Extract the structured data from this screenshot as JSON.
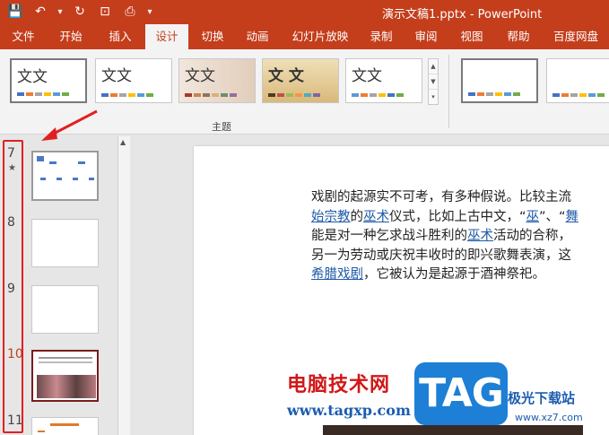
{
  "titlebar": {
    "title": "演示文稿1.pptx - PowerPoint",
    "qat": [
      {
        "name": "save-icon",
        "glyph": "💾"
      },
      {
        "name": "undo-icon",
        "glyph": "↶"
      },
      {
        "name": "undo-dropdown-icon",
        "glyph": "▾"
      },
      {
        "name": "redo-icon",
        "glyph": "↻"
      },
      {
        "name": "present-icon",
        "glyph": "⊡"
      },
      {
        "name": "preview-icon",
        "glyph": "⎙"
      },
      {
        "name": "qat-customize-icon",
        "glyph": "▾"
      }
    ]
  },
  "tabs": [
    "文件",
    "开始",
    "插入",
    "设计",
    "切换",
    "动画",
    "幻灯片放映",
    "录制",
    "审阅",
    "视图",
    "帮助",
    "百度网盘"
  ],
  "active_tab": "设计",
  "ribbon": {
    "themes_group_label": "主题",
    "theme_text": "文文",
    "theme_text_sample": "文 文"
  },
  "slides": [
    {
      "number": "7",
      "has_star": true
    },
    {
      "number": "8",
      "has_star": false
    },
    {
      "number": "9",
      "has_star": false
    },
    {
      "number": "10",
      "has_star": false
    },
    {
      "number": "11",
      "has_star": false
    }
  ],
  "slide_star": "★",
  "slide_content": {
    "line1": "戏剧的起源实不可考，有多种假说。比较主流",
    "line2_link1": "始宗教",
    "line2_mid1": "的",
    "line2_link2": "巫术",
    "line2_mid2": "仪式，比如上古中文，“",
    "line2_link3": "巫",
    "line2_mid3": "”、“",
    "line2_link4": "舞",
    "line3_pre": "能是对一种乞求战斗胜利的",
    "line3_link": "巫术",
    "line3_post": "活动的合称，",
    "line4": "另一为劳动或庆祝丰收时的即兴歌舞表演，这",
    "line5_link": "希腊戏剧",
    "line5_post": "，它被认为是起源于酒神祭祀。"
  },
  "watermark": {
    "cn_name": "电脑技术网",
    "url": "www.tagxp.com",
    "tag": "TAG",
    "site": "极光下载站",
    "site_url": "www.xz7.com"
  },
  "colors": {
    "accent": "#c43e1c",
    "highlight_box": "#e02020",
    "link": "#1f5aa6"
  }
}
